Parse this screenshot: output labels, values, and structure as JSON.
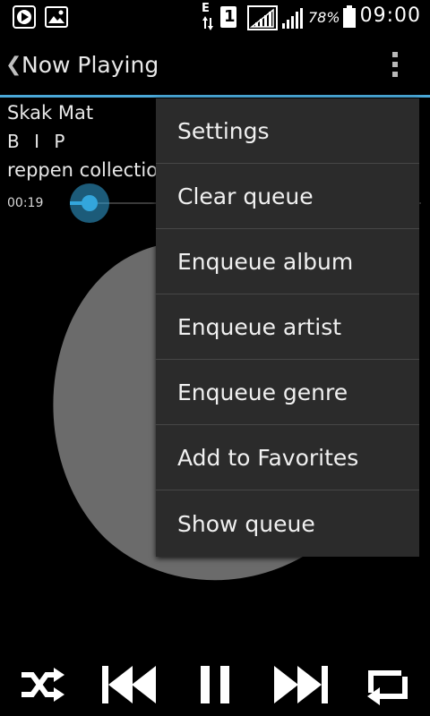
{
  "status_bar": {
    "network_type": "E",
    "sim_slot": "1",
    "battery_percent": "78%",
    "time": "09:00",
    "icons": [
      "play-notification-icon",
      "image-notification-icon",
      "data-arrows-icon",
      "signal-icon",
      "battery-icon"
    ]
  },
  "action_bar": {
    "title": "Now Playing"
  },
  "track": {
    "title": "Skak Mat",
    "artist": "B I P",
    "album": "reppen collectio",
    "elapsed": "00:19",
    "progress_fraction": 0.01
  },
  "menu": {
    "items": [
      "Settings",
      "Clear queue",
      "Enqueue album",
      "Enqueue artist",
      "Enqueue genre",
      "Add to Favorites",
      "Show queue"
    ]
  },
  "colors": {
    "accent": "#33a6dc",
    "menu_bg": "#2b2b2b",
    "artwork": "#6b6b6b"
  },
  "controls": [
    "shuffle-icon",
    "previous-icon",
    "pause-icon",
    "next-icon",
    "repeat-icon"
  ]
}
